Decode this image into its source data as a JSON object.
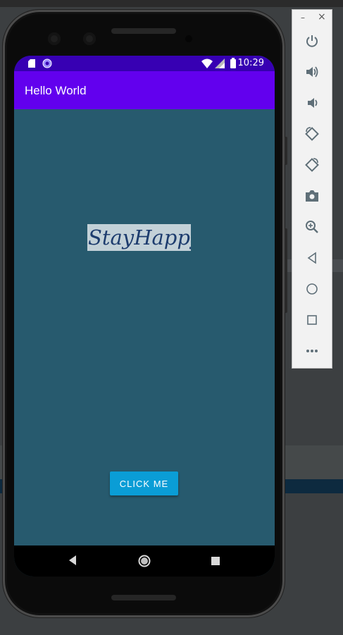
{
  "app": {
    "title": "Hello World"
  },
  "status_bar": {
    "time": "10:29"
  },
  "main": {
    "logo_text": "StayHappy",
    "button_label": "CLICK ME"
  },
  "emulator": {
    "window": {
      "minimize": "–",
      "close": "×"
    },
    "tools": [
      {
        "icon": "power-icon"
      },
      {
        "icon": "volume-up-icon"
      },
      {
        "icon": "volume-down-icon"
      },
      {
        "icon": "rotate-left-icon"
      },
      {
        "icon": "rotate-right-icon"
      },
      {
        "icon": "camera-icon"
      },
      {
        "icon": "zoom-icon"
      },
      {
        "icon": "back-icon"
      },
      {
        "icon": "home-icon"
      },
      {
        "icon": "overview-icon"
      },
      {
        "icon": "more-icon"
      }
    ]
  },
  "colors": {
    "status_bar": "#3700b3",
    "app_bar": "#6200ee",
    "content_bg": "#275a6e",
    "button": "#0a9dd6",
    "logo_text": "#1d3c6e"
  }
}
